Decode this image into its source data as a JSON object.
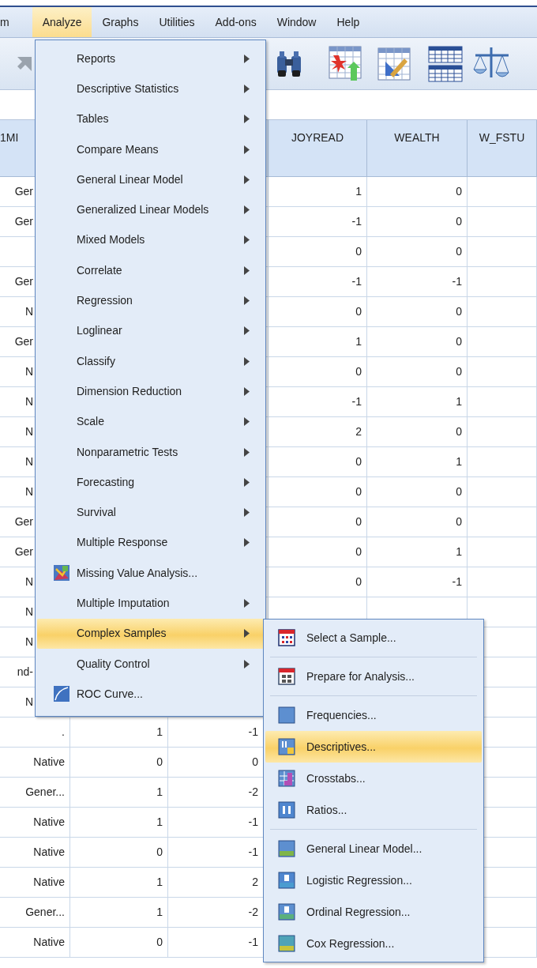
{
  "menubar": [
    {
      "label": "m",
      "selected": false
    },
    {
      "label": "Analyze",
      "selected": true
    },
    {
      "label": "Graphs",
      "selected": false
    },
    {
      "label": "Utilities",
      "selected": false
    },
    {
      "label": "Add-ons",
      "selected": false
    },
    {
      "label": "Window",
      "selected": false
    },
    {
      "label": "Help",
      "selected": false
    }
  ],
  "grid": {
    "columns": [
      "1MI",
      null,
      null,
      "JOYREAD",
      "WEALTH",
      "W_FSTU"
    ],
    "rows": [
      [
        "Ger",
        null,
        null,
        "1",
        "0",
        null
      ],
      [
        "Ger",
        null,
        null,
        "-1",
        "0",
        null
      ],
      [
        null,
        null,
        null,
        "0",
        "0",
        null
      ],
      [
        "Ger",
        null,
        null,
        "-1",
        "-1",
        null
      ],
      [
        "N",
        null,
        null,
        "0",
        "0",
        null
      ],
      [
        "Ger",
        null,
        null,
        "1",
        "0",
        null
      ],
      [
        "N",
        null,
        null,
        "0",
        "0",
        null
      ],
      [
        "N",
        null,
        null,
        "-1",
        "1",
        null
      ],
      [
        "N",
        null,
        null,
        "2",
        "0",
        null
      ],
      [
        "N",
        null,
        null,
        "0",
        "1",
        null
      ],
      [
        "N",
        null,
        null,
        "0",
        "0",
        null
      ],
      [
        "Ger",
        null,
        null,
        "0",
        "0",
        null
      ],
      [
        "Ger",
        null,
        null,
        "0",
        "1",
        null
      ],
      [
        "N",
        null,
        null,
        "0",
        "-1",
        null
      ],
      [
        "N",
        null,
        null,
        null,
        null,
        null
      ],
      [
        "N",
        null,
        null,
        null,
        null,
        null
      ],
      [
        "nd-",
        null,
        null,
        null,
        null,
        null
      ],
      [
        "N",
        null,
        null,
        null,
        null,
        null
      ],
      [
        ".",
        "1",
        "-1",
        null,
        null,
        null
      ],
      [
        "Native",
        "0",
        "0",
        null,
        null,
        null
      ],
      [
        "Gener...",
        "1",
        "-2",
        null,
        null,
        null
      ],
      [
        "Native",
        "1",
        "-1",
        null,
        null,
        null
      ],
      [
        "Native",
        "0",
        "-1",
        null,
        null,
        null
      ],
      [
        "Native",
        "1",
        "2",
        null,
        null,
        null
      ],
      [
        "Gener...",
        "1",
        "-2",
        null,
        null,
        null
      ],
      [
        "Native",
        "0",
        "-1",
        null,
        null,
        null
      ]
    ]
  },
  "analyze_menu": {
    "items": [
      {
        "label": "Reports",
        "kind": "submenu",
        "selected": false
      },
      {
        "label": "Descriptive Statistics",
        "kind": "submenu",
        "selected": false
      },
      {
        "label": "Tables",
        "kind": "submenu",
        "selected": false
      },
      {
        "label": "Compare Means",
        "kind": "submenu",
        "selected": false
      },
      {
        "label": "General Linear Model",
        "kind": "submenu",
        "selected": false
      },
      {
        "label": "Generalized Linear Models",
        "kind": "submenu",
        "selected": false
      },
      {
        "label": "Mixed Models",
        "kind": "submenu",
        "selected": false
      },
      {
        "label": "Correlate",
        "kind": "submenu",
        "selected": false
      },
      {
        "label": "Regression",
        "kind": "submenu",
        "selected": false
      },
      {
        "label": "Loglinear",
        "kind": "submenu",
        "selected": false
      },
      {
        "label": "Classify",
        "kind": "submenu",
        "selected": false
      },
      {
        "label": "Dimension Reduction",
        "kind": "submenu",
        "selected": false
      },
      {
        "label": "Scale",
        "kind": "submenu",
        "selected": false
      },
      {
        "label": "Nonparametric Tests",
        "kind": "submenu",
        "selected": false
      },
      {
        "label": "Forecasting",
        "kind": "submenu",
        "selected": false
      },
      {
        "label": "Survival",
        "kind": "submenu",
        "selected": false
      },
      {
        "label": "Multiple Response",
        "kind": "submenu",
        "selected": false
      },
      {
        "label": "Missing Value Analysis...",
        "kind": "command",
        "selected": false
      },
      {
        "label": "Multiple Imputation",
        "kind": "submenu",
        "selected": false
      },
      {
        "label": "Complex Samples",
        "kind": "submenu",
        "selected": true
      },
      {
        "label": "Quality Control",
        "kind": "submenu",
        "selected": false
      },
      {
        "label": "ROC Curve...",
        "kind": "command",
        "selected": false
      }
    ]
  },
  "complex_samples_menu": {
    "items": [
      {
        "label": "Select a Sample...",
        "separator_before": false,
        "selected": false
      },
      {
        "label": "Prepare for Analysis...",
        "separator_before": true,
        "selected": false
      },
      {
        "label": "Frequencies...",
        "separator_before": true,
        "selected": false
      },
      {
        "label": "Descriptives...",
        "separator_before": false,
        "selected": true
      },
      {
        "label": "Crosstabs...",
        "separator_before": false,
        "selected": false
      },
      {
        "label": "Ratios...",
        "separator_before": false,
        "selected": false
      },
      {
        "label": "General Linear Model...",
        "separator_before": true,
        "selected": false
      },
      {
        "label": "Logistic Regression...",
        "separator_before": false,
        "selected": false
      },
      {
        "label": "Ordinal Regression...",
        "separator_before": false,
        "selected": false
      },
      {
        "label": "Cox Regression...",
        "separator_before": false,
        "selected": false
      }
    ]
  }
}
